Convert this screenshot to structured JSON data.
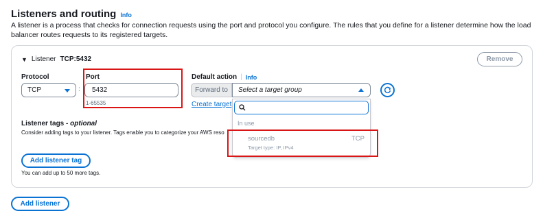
{
  "section": {
    "title": "Listeners and routing",
    "info": "Info",
    "description": "A listener is a process that checks for connection requests using the port and protocol you configure. The rules that you define for a listener determine how the load balancer routes requests to its registered targets."
  },
  "listener": {
    "prefix": "Listener",
    "name": "TCP:5432",
    "remove_label": "Remove",
    "protocol": {
      "label": "Protocol",
      "value": "TCP"
    },
    "port": {
      "label": "Port",
      "value": "5432",
      "hint": "1-65535"
    },
    "default_action": {
      "label": "Default action",
      "info": "Info",
      "forward_to": "Forward to",
      "placeholder": "Select a target group",
      "create_link": "Create target",
      "dropdown": {
        "search_value": "",
        "group_label": "In use",
        "options": [
          {
            "name": "sourcedb",
            "protocol": "TCP",
            "description": "Target type: IP, IPv4"
          }
        ]
      }
    },
    "tags": {
      "title": "Listener tags",
      "optional": "optional",
      "description": "Consider adding tags to your listener. Tags enable you to categorize your AWS reso",
      "add_label": "Add listener tag",
      "limit_text": "You can add up to 50 more tags."
    }
  },
  "add_listener_label": "Add listener",
  "colors": {
    "accent": "#0972d3",
    "highlight": "#d91515",
    "muted": "#8d99a8"
  }
}
